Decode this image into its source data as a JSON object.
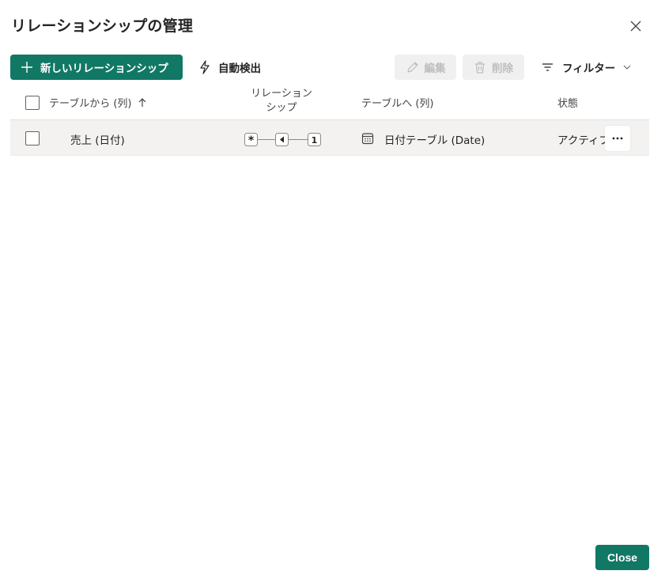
{
  "dialog": {
    "title": "リレーションシップの管理",
    "close_footer_label": "Close"
  },
  "toolbar": {
    "new_relationship_label": "新しいリレーションシップ",
    "auto_detect_label": "自動検出",
    "edit_label": "編集",
    "delete_label": "削除",
    "filter_label": "フィルター"
  },
  "table": {
    "columns": {
      "from": "テーブルから (列)",
      "relationship_line1": "リレーション",
      "relationship_line2": "シップ",
      "to": "テーブルへ (列)",
      "status": "状態"
    },
    "rows": [
      {
        "from": "売上 (日付)",
        "cardinality_from": "*",
        "cardinality_to": "1",
        "to": "日付テーブル (Date)",
        "status": "アクティブ"
      }
    ]
  },
  "colors": {
    "accent": "#117865",
    "row_bg": "#f3f2f1",
    "disabled_bg": "#f0f0f0",
    "disabled_text": "#bdbdbd"
  }
}
